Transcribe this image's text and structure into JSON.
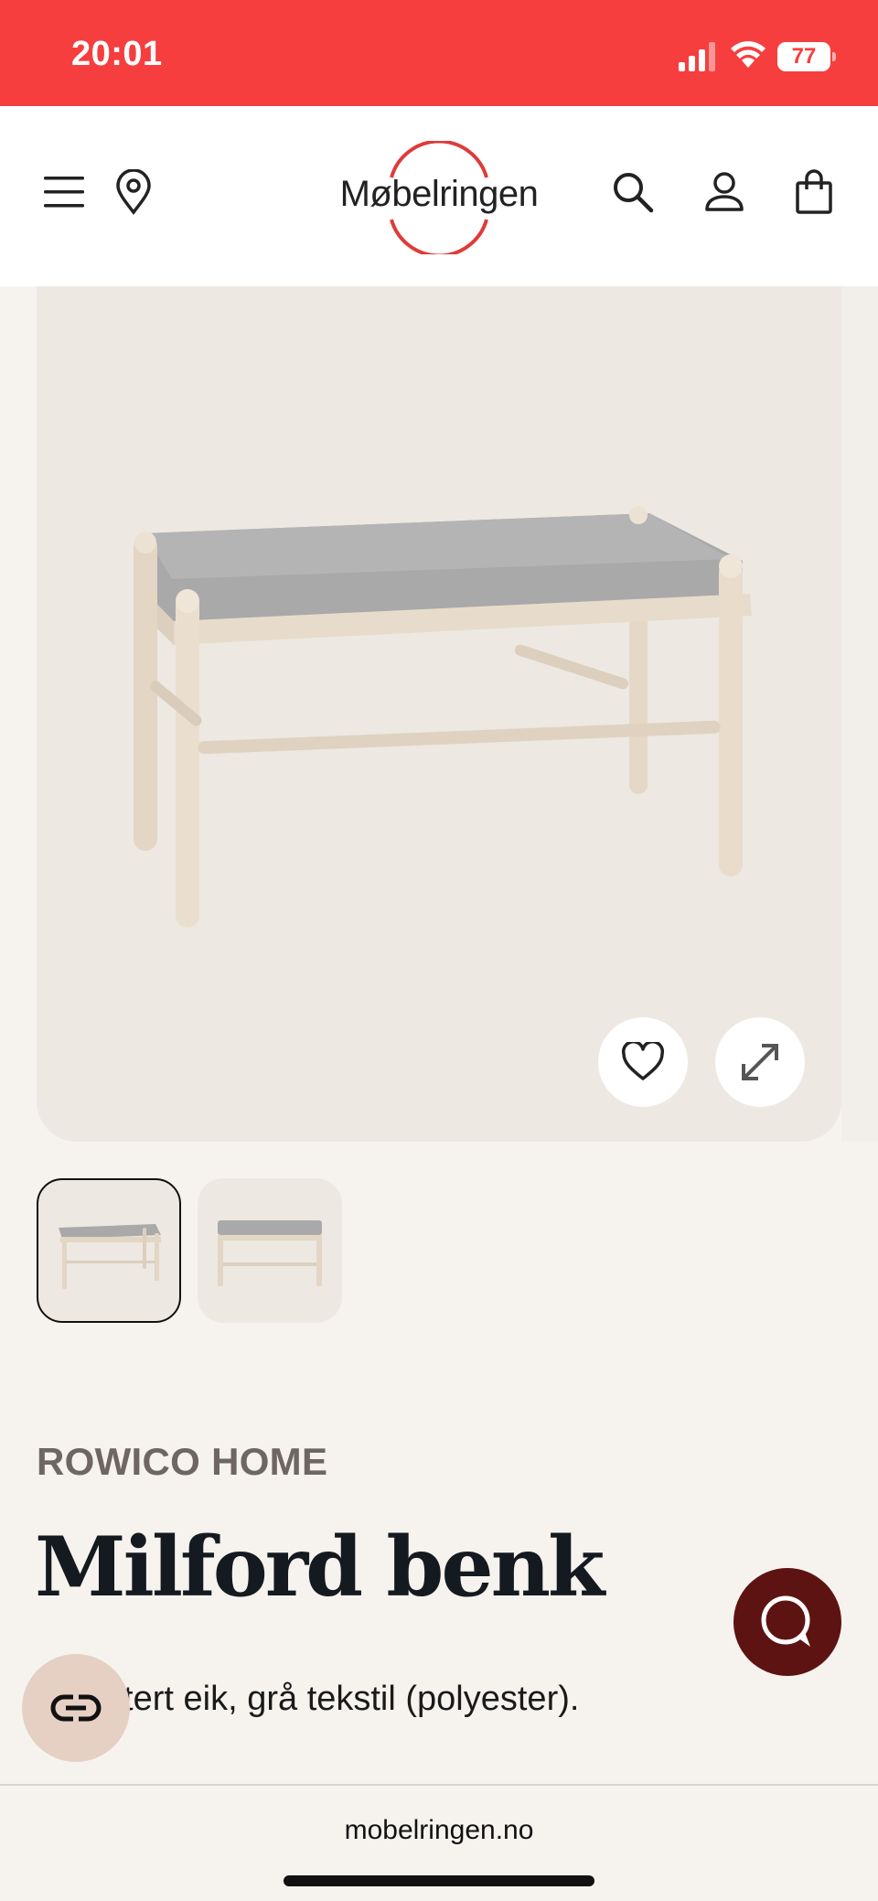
{
  "status_bar": {
    "time": "20:01",
    "battery": "77",
    "signal_icon": "cellular-signal-icon",
    "wifi_icon": "wifi-icon",
    "background": "#f63e3e"
  },
  "header": {
    "logo_text": "Møbelringen",
    "logo_accent": "#e03a3a",
    "icons": [
      "menu-icon",
      "location-pin-icon",
      "search-icon",
      "account-icon",
      "shopping-bag-icon"
    ]
  },
  "product": {
    "brand": "ROWICO HOME",
    "title": "Milford benk",
    "description": "gmentert eik, grå tekstil (polyester).",
    "image_actions": [
      "heart-icon",
      "expand-icon"
    ],
    "thumbnails": [
      {
        "selected": true
      },
      {
        "selected": false
      }
    ]
  },
  "floating": {
    "compare_icon": "compare-toggle-icon",
    "chat_icon": "chat-bubble-icon",
    "chat_color": "#5e1313"
  },
  "browser": {
    "url": "mobelringen.no"
  }
}
